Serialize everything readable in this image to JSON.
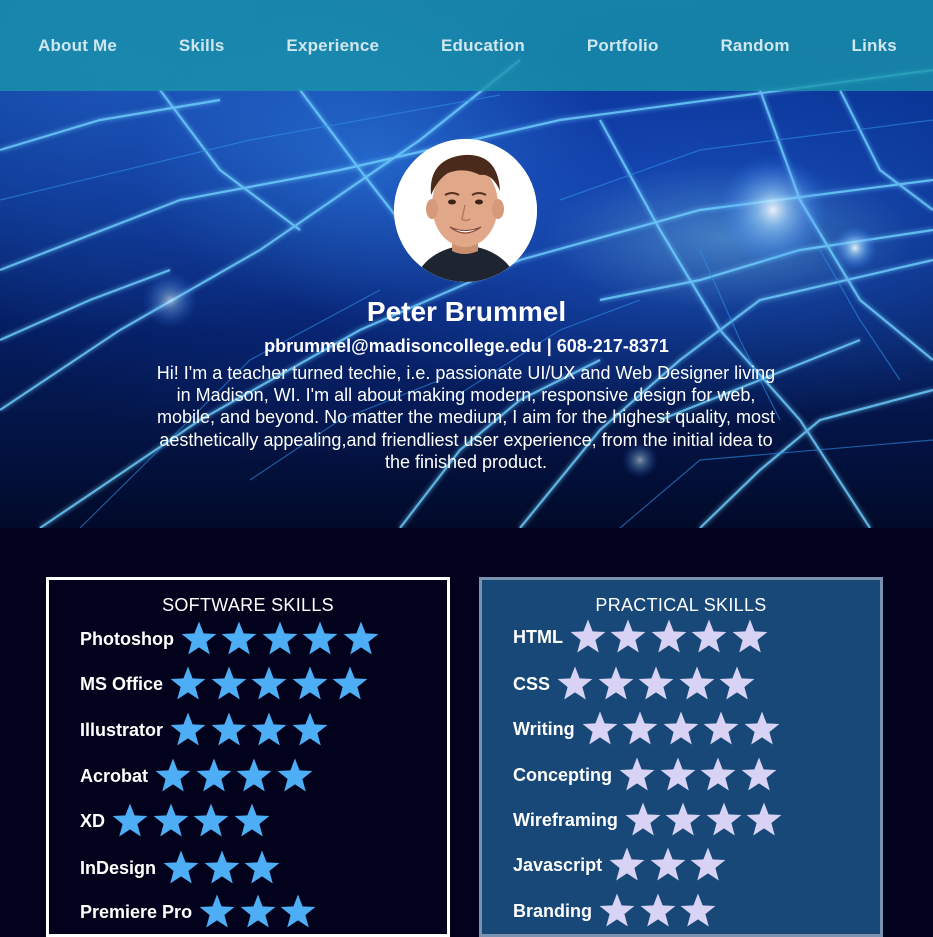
{
  "nav": {
    "items": [
      "About Me",
      "Skills",
      "Experience",
      "Education",
      "Portfolio",
      "Random",
      "Links"
    ]
  },
  "profile": {
    "name": "Peter Brummel",
    "contact": "pbrummel@madisoncollege.edu | 608-217-8371",
    "bio": "Hi! I'm a teacher turned techie, i.e. passionate UI/UX and Web Designer living in Madison, WI. I'm all about making modern, responsive design for web, mobile, and beyond. No matter the medium, I aim for the highest quality, most aesthetically appealing,and friendliest user experience, from the initial idea to the finished product."
  },
  "software_skills": {
    "title": "SOFTWARE SKILLS",
    "star_color": "#4daef5",
    "items": [
      {
        "label": "Photoshop",
        "rating": 5
      },
      {
        "label": "MS Office",
        "rating": 5
      },
      {
        "label": "Illustrator",
        "rating": 4
      },
      {
        "label": "Acrobat",
        "rating": 4
      },
      {
        "label": "XD",
        "rating": 4
      },
      {
        "label": "InDesign",
        "rating": 3
      },
      {
        "label": "Premiere Pro",
        "rating": 3
      }
    ]
  },
  "practical_skills": {
    "title": "PRACTICAL SKILLS",
    "star_color": "#d8d2f4",
    "items": [
      {
        "label": "HTML",
        "rating": 5
      },
      {
        "label": "CSS",
        "rating": 5
      },
      {
        "label": "Writing",
        "rating": 5
      },
      {
        "label": "Concepting",
        "rating": 4
      },
      {
        "label": "Wireframing",
        "rating": 4
      },
      {
        "label": "Javascript",
        "rating": 3
      },
      {
        "label": "Branding",
        "rating": 3
      }
    ]
  }
}
